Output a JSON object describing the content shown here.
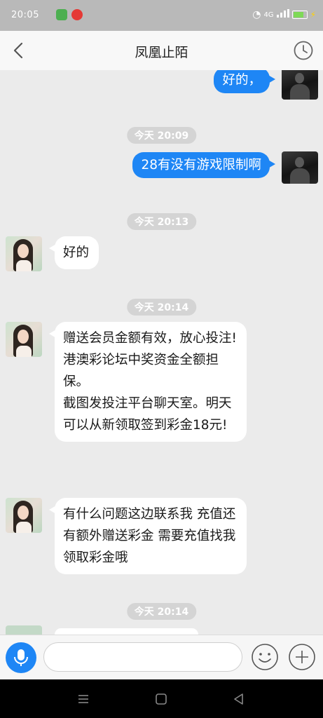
{
  "status_bar": {
    "time": "20:05",
    "network": "4G"
  },
  "header": {
    "title": "凤凰止陌"
  },
  "messages": [
    {
      "type": "out",
      "text": "好的，"
    },
    {
      "type": "timestamp",
      "text": "今天 20:09"
    },
    {
      "type": "out",
      "text": "28有没有游戏限制啊"
    },
    {
      "type": "timestamp",
      "text": "今天 20:13"
    },
    {
      "type": "in",
      "text": "好的"
    },
    {
      "type": "timestamp",
      "text": "今天 20:14"
    },
    {
      "type": "in",
      "lines": [
        "赠送会员金额有效，放心投注!",
        "港澳彩论坛中奖资金全额担保。",
        "截图发投注平台聊天室。明天可以从新领取签到彩金18元!"
      ]
    },
    {
      "type": "in",
      "text": "有什么问题这边联系我  充值还有额外赠送彩金   需要充值找我领取彩金哦"
    },
    {
      "type": "timestamp",
      "text": "今天 20:14"
    }
  ],
  "input": {
    "placeholder": ""
  },
  "icons": {
    "back": "chevron-left-icon",
    "history": "clock-icon",
    "voice": "microphone-icon",
    "emoji": "smiley-icon",
    "more": "plus-icon",
    "nav_menu": "menu-icon",
    "nav_home": "home-icon",
    "nav_back": "back-triangle-icon"
  },
  "colors": {
    "outgoing_bubble": "#1e86f5",
    "incoming_bubble": "#ffffff",
    "chat_background": "#ebebeb",
    "timestamp_pill": "#d4d4d4"
  }
}
